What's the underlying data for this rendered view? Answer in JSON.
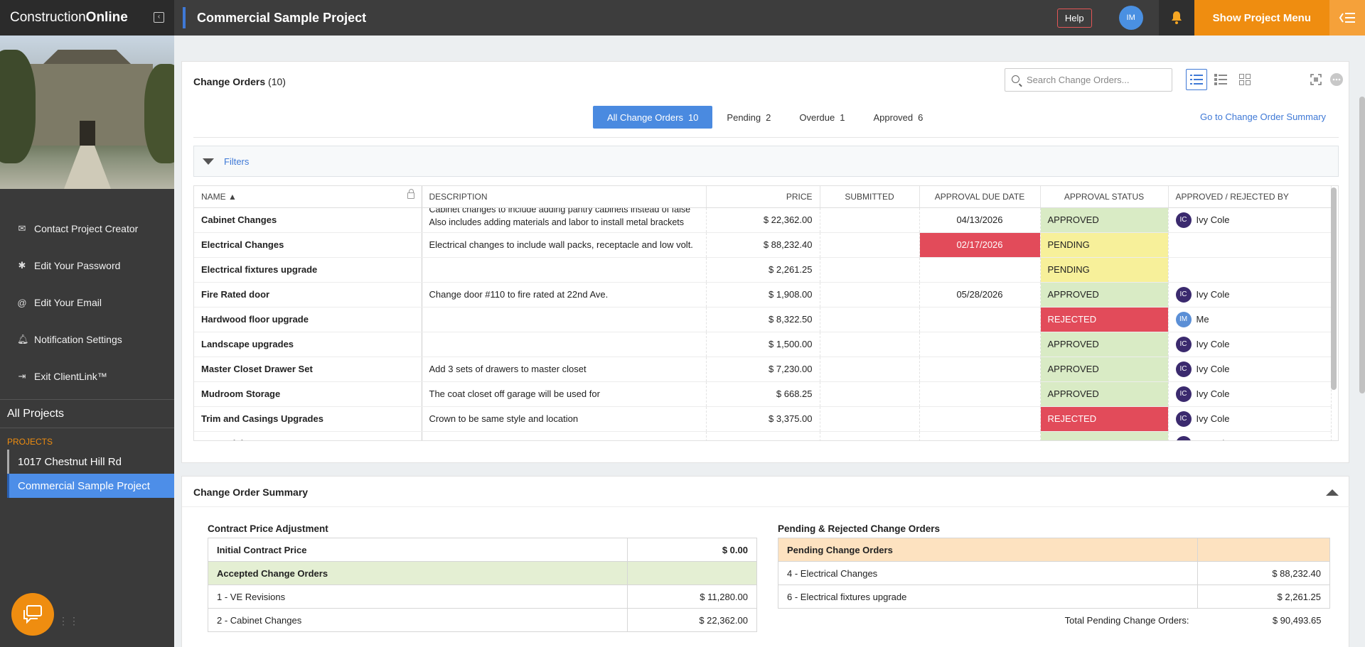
{
  "app": {
    "logo_thin": "Construction",
    "logo_bold": "Online",
    "project_title": "Commercial Sample Project",
    "help_label": "Help",
    "user_initials": "IM",
    "show_menu_label": "Show Project Menu"
  },
  "sidebar": {
    "links": [
      {
        "icon": "envelope-icon",
        "label": "Contact Project Creator"
      },
      {
        "icon": "password-icon",
        "label": "Edit Your Password"
      },
      {
        "icon": "at-icon",
        "label": "Edit Your Email"
      },
      {
        "icon": "bell-icon",
        "label": "Notification Settings"
      },
      {
        "icon": "exit-icon",
        "label": "Exit ClientLink™"
      }
    ],
    "all_projects": "All Projects",
    "projects_label": "PROJECTS",
    "projects": [
      "1017 Chestnut Hill Rd",
      "Commercial Sample Project"
    ]
  },
  "change_orders": {
    "title": "Change Orders",
    "count": "(10)",
    "search_placeholder": "Search Change Orders...",
    "tabs": [
      {
        "label": "All Change Orders",
        "count": "10"
      },
      {
        "label": "Pending",
        "count": "2"
      },
      {
        "label": "Overdue",
        "count": "1"
      },
      {
        "label": "Approved",
        "count": "6"
      }
    ],
    "summary_link": "Go to Change Order Summary",
    "filters_label": "Filters",
    "columns": [
      "NAME",
      "DESCRIPTION",
      "PRICE",
      "SUBMITTED",
      "APPROVAL DUE DATE",
      "APPROVAL STATUS",
      "APPROVED / REJECTED BY"
    ],
    "rows": [
      {
        "name": "Cabinet Changes",
        "desc1": "Cabinet changes to include adding pantry cabinets instead of false",
        "desc2": "Also includes adding materials and labor to install metal brackets",
        "price": "$ 22,362.00",
        "submitted": "",
        "due": "04/13/2026",
        "due_overdue": false,
        "status": "APPROVED",
        "by_initials": "IC",
        "by": "Ivy Cole"
      },
      {
        "name": "Electrical Changes",
        "desc1": "Electrical changes to include wall packs, receptacle and low volt.",
        "desc2": "",
        "price": "$ 88,232.40",
        "submitted": "",
        "due": "02/17/2026",
        "due_overdue": true,
        "status": "PENDING",
        "by_initials": "",
        "by": ""
      },
      {
        "name": "Electrical fixtures upgrade",
        "desc1": "",
        "desc2": "",
        "price": "$ 2,261.25",
        "submitted": "",
        "due": "",
        "due_overdue": false,
        "status": "PENDING",
        "by_initials": "",
        "by": ""
      },
      {
        "name": "Fire Rated door",
        "desc1": "Change door #110 to fire rated at 22nd Ave.",
        "desc2": "",
        "price": "$ 1,908.00",
        "submitted": "",
        "due": "05/28/2026",
        "due_overdue": false,
        "status": "APPROVED",
        "by_initials": "IC",
        "by": "Ivy Cole"
      },
      {
        "name": "Hardwood floor upgrade",
        "desc1": "",
        "desc2": "",
        "price": "$ 8,322.50",
        "submitted": "",
        "due": "",
        "due_overdue": false,
        "status": "REJECTED",
        "by_initials": "IM",
        "by": "Me"
      },
      {
        "name": "Landscape upgrades",
        "desc1": "",
        "desc2": "",
        "price": "$ 1,500.00",
        "submitted": "",
        "due": "",
        "due_overdue": false,
        "status": "APPROVED",
        "by_initials": "IC",
        "by": "Ivy Cole"
      },
      {
        "name": "Master Closet Drawer Set",
        "desc1": "Add 3 sets of drawers to master closet",
        "desc2": "",
        "price": "$ 7,230.00",
        "submitted": "",
        "due": "",
        "due_overdue": false,
        "status": "APPROVED",
        "by_initials": "IC",
        "by": "Ivy Cole"
      },
      {
        "name": "Mudroom Storage",
        "desc1": "The coat closet off garage will be used for",
        "desc2": "",
        "price": "$ 668.25",
        "submitted": "",
        "due": "",
        "due_overdue": false,
        "status": "APPROVED",
        "by_initials": "IC",
        "by": "Ivy Cole"
      },
      {
        "name": "Trim and Casings Upgrades",
        "desc1": "Crown to be same style and location",
        "desc2": "",
        "price": "$ 3,375.00",
        "submitted": "",
        "due": "",
        "due_overdue": false,
        "status": "REJECTED",
        "by_initials": "IC",
        "by": "Ivy Cole"
      },
      {
        "name": "VE Revisions",
        "desc1": "",
        "desc2": "",
        "price": "",
        "submitted": "",
        "due": "",
        "due_overdue": false,
        "status": "APPROVED",
        "by_initials": "IC",
        "by": "Ivy Cole"
      }
    ]
  },
  "summary": {
    "title": "Change Order Summary",
    "contract_heading": "Contract Price Adjustment",
    "initial_label": "Initial Contract Price",
    "initial_value": "$ 0.00",
    "accepted_label": "Accepted Change Orders",
    "accepted": [
      {
        "label": "1 - VE Revisions",
        "value": "$ 11,280.00"
      },
      {
        "label": "2 - Cabinet Changes",
        "value": "$ 22,362.00"
      }
    ],
    "pending_heading": "Pending & Rejected Change Orders",
    "pending_label": "Pending Change Orders",
    "pending": [
      {
        "label": "4 - Electrical Changes",
        "value": "$ 88,232.40"
      },
      {
        "label": "6 - Electrical fixtures upgrade",
        "value": "$ 2,261.25"
      }
    ],
    "total_pending_label": "Total Pending Change Orders:",
    "total_pending_value": "$ 90,493.65"
  },
  "colors": {
    "accent": "#4a8ae0",
    "orange": "#ef8d10",
    "approved": "#d9ebc5",
    "pending": "#f7f09a",
    "rejected": "#e24b5a"
  }
}
